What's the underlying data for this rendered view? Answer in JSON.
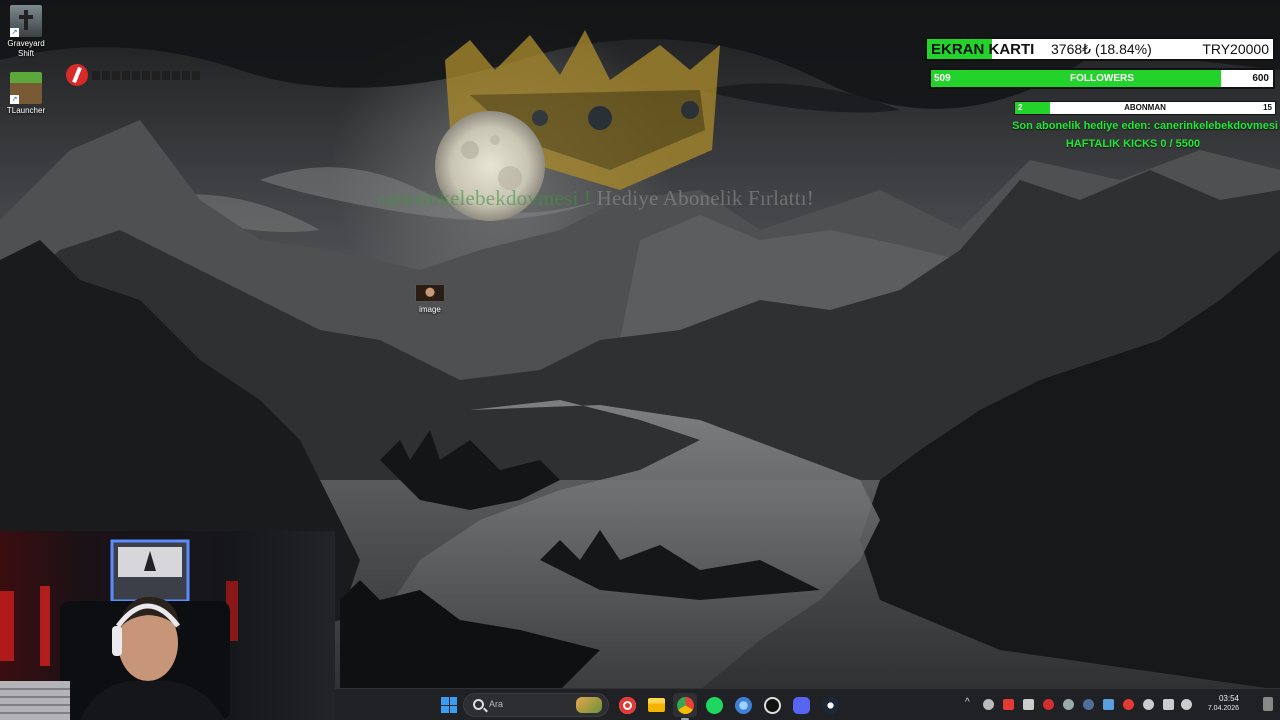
{
  "desktop": {
    "icons": [
      {
        "label_line1": "Graveyard",
        "label_line2": "Shift",
        "icon": "graveyard-shift-icon"
      },
      {
        "label_line1": "TLauncher",
        "icon": "tlauncher-icon"
      }
    ],
    "image_file_label": "image",
    "shortcut_arrow": "↗"
  },
  "alert": {
    "username": "canerinkelebekdovmesi",
    "separator": "!",
    "message": "Hediye Abonelik Fırlattı!"
  },
  "widgets": {
    "goal": {
      "name": "EKRAN KARTI",
      "progress_text": "3768₺ (18.84%)",
      "target_text": "TRY20000",
      "fill_fraction": 0.1884,
      "fill_color": "#23d22a"
    },
    "followers": {
      "current": "509",
      "label": "FOLLOWERS",
      "goal": "600",
      "fill_fraction": 0.848
    },
    "subs": {
      "current": "2",
      "label": "ABONMAN",
      "goal": "15",
      "fill_fraction": 0.133
    },
    "last_gift_text": "Son abonelik hediye eden: canerinkelebekdovmesi",
    "weekly_kicks_text": "HAFTALIK KICKS 0 / 5500",
    "accent_color": "#22e634"
  },
  "taskbar": {
    "search_placeholder": "Ara",
    "apps": [
      "start-windows-icon",
      "search",
      "youtube-music-icon",
      "file-explorer-icon",
      "chrome-icon",
      "spotify-icon",
      "snipping-tool-icon",
      "github-desktop-icon",
      "discord-icon",
      "steam-icon"
    ],
    "tray_chevron": "^",
    "clock": {
      "time": "03:54",
      "date": "7.04.2026"
    }
  }
}
